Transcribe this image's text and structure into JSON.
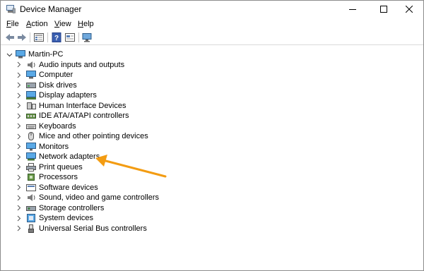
{
  "window": {
    "title": "Device Manager",
    "minimize_icon": "minimize-icon",
    "maximize_icon": "maximize-icon",
    "close_icon": "close-icon"
  },
  "menu": {
    "items": [
      {
        "label": "File",
        "accel": "F"
      },
      {
        "label": "Action",
        "accel": "A"
      },
      {
        "label": "View",
        "accel": "V"
      },
      {
        "label": "Help",
        "accel": "H"
      }
    ]
  },
  "toolbar": {
    "buttons": [
      "back-arrow-icon",
      "forward-arrow-icon",
      "properties-icon",
      "help-icon",
      "scan-hardware-icon",
      "monitor-icon"
    ]
  },
  "tree": {
    "root": "Martin-PC",
    "categories": [
      "Audio inputs and outputs",
      "Computer",
      "Disk drives",
      "Display adapters",
      "Human Interface Devices",
      "IDE ATA/ATAPI controllers",
      "Keyboards",
      "Mice and other pointing devices",
      "Monitors",
      "Network adapters",
      "Print queues",
      "Processors",
      "Software devices",
      "Sound, video and game controllers",
      "Storage controllers",
      "System devices",
      "Universal Serial Bus controllers"
    ]
  },
  "annotation": {
    "color": "#f39c12",
    "points_to": "Network adapters"
  }
}
